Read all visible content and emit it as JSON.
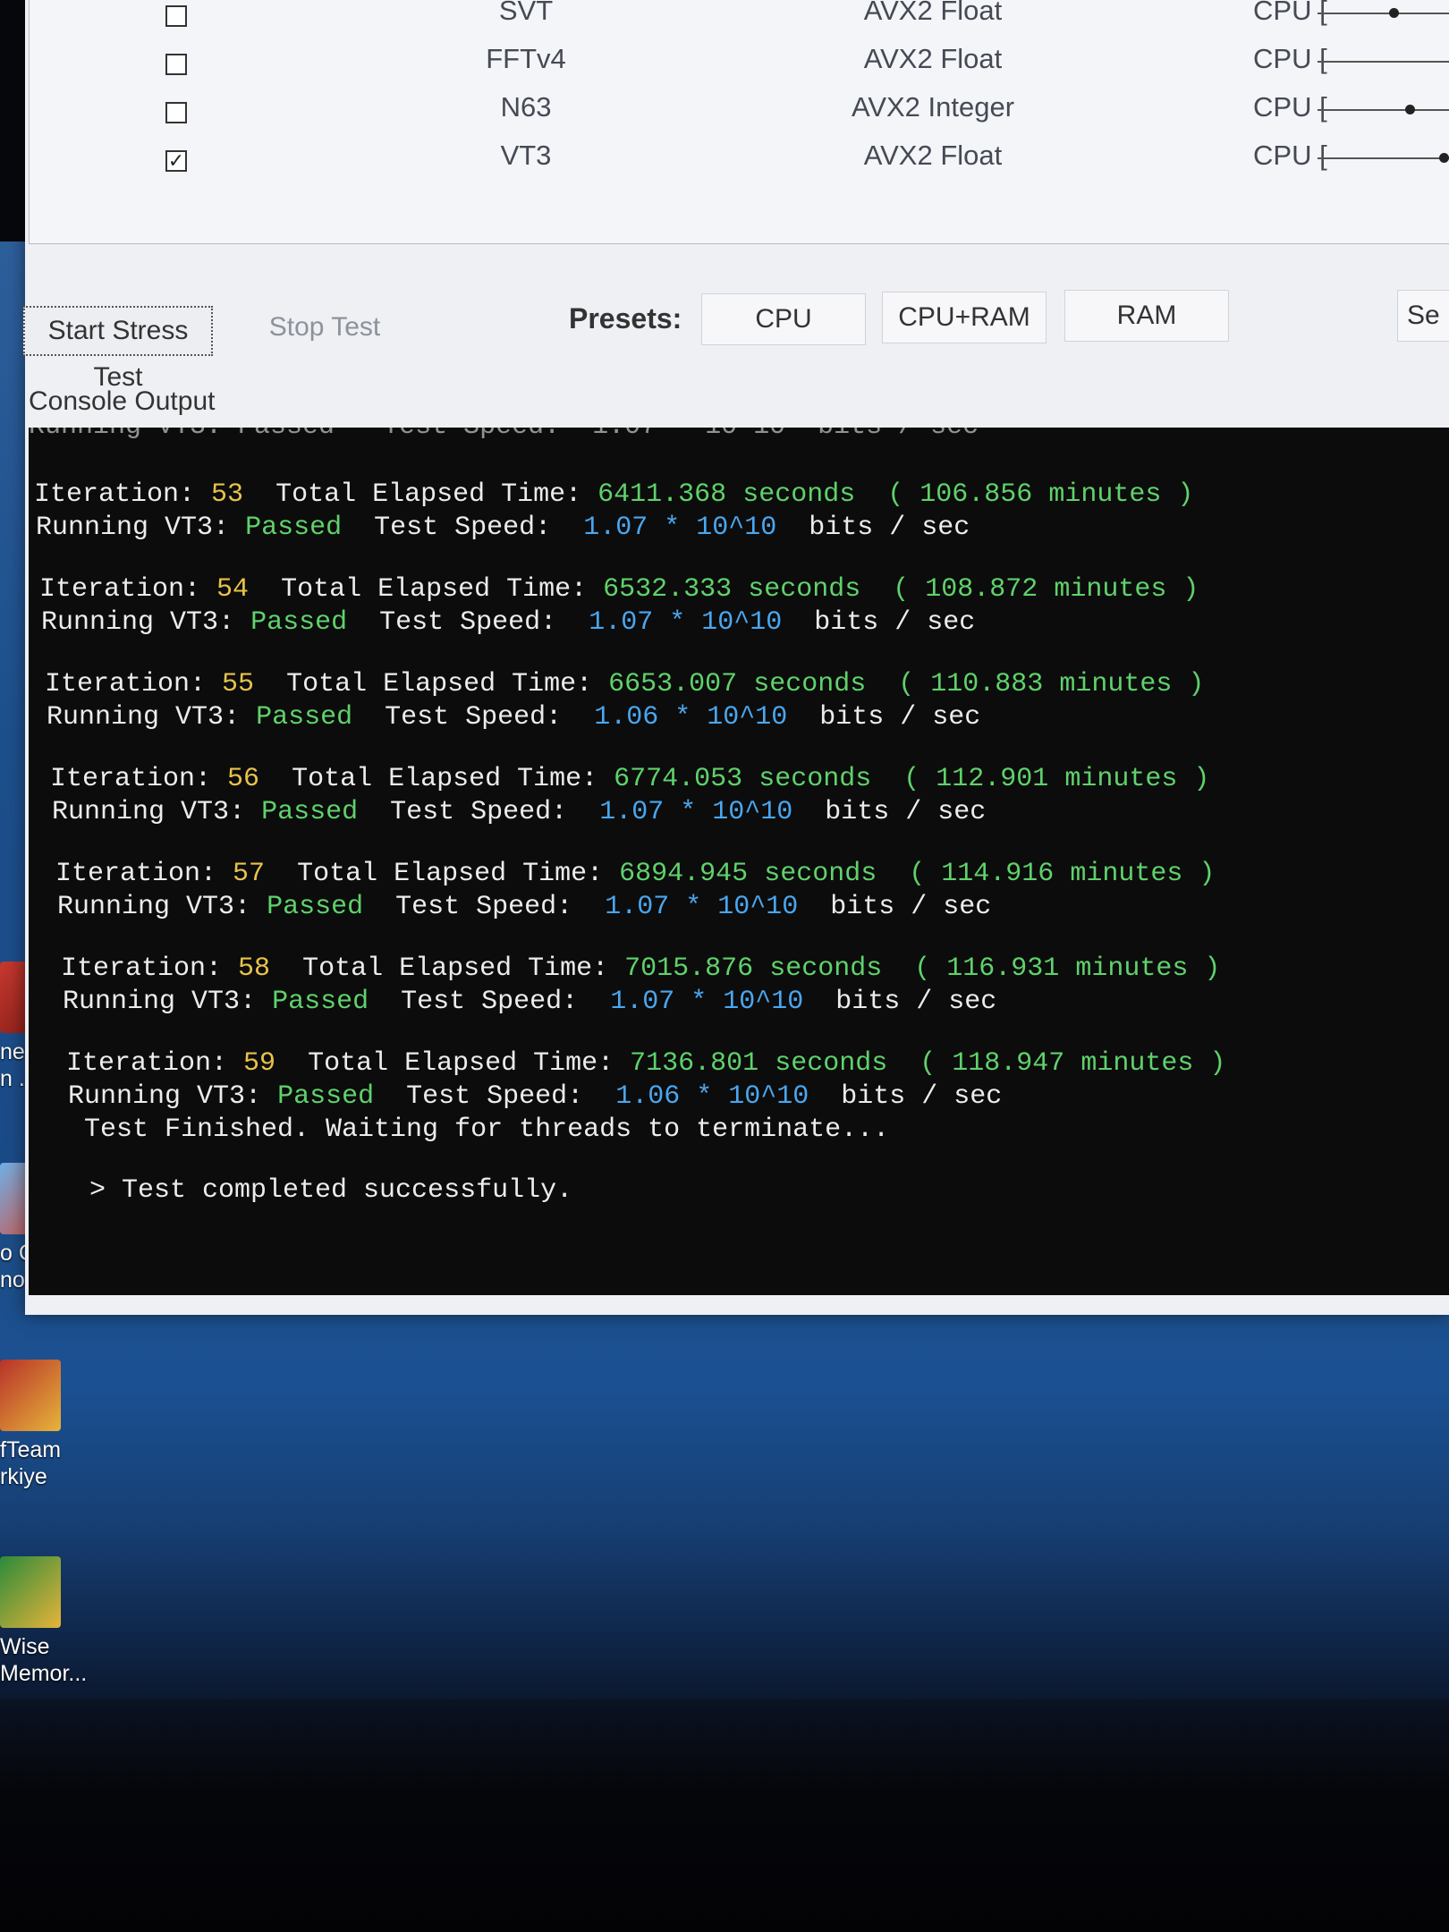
{
  "tests": [
    {
      "name": "SVT",
      "isa": "AVX2 Float",
      "cpu": "CPU [",
      "checked": false
    },
    {
      "name": "FFTv4",
      "isa": "AVX2 Float",
      "cpu": "CPU [",
      "checked": false
    },
    {
      "name": "N63",
      "isa": "AVX2 Integer",
      "cpu": "CPU [",
      "checked": false
    },
    {
      "name": "VT3",
      "isa": "AVX2 Float",
      "cpu": "CPU [",
      "checked": true
    }
  ],
  "toolbar": {
    "start_label": "Start Stress Test",
    "stop_label": "Stop Test",
    "presets_label": "Presets:",
    "preset_cpu": "CPU",
    "preset_cpu_ram": "CPU+RAM",
    "preset_ram": "RAM",
    "preset_more": "Se"
  },
  "console": {
    "label": "Console Output",
    "iterations": [
      {
        "n": "53",
        "seconds": "6411.368",
        "minutes": "106.856",
        "test": "VT3",
        "status": "Passed",
        "speed": "1.07",
        "exp": "10^10"
      },
      {
        "n": "54",
        "seconds": "6532.333",
        "minutes": "108.872",
        "test": "VT3",
        "status": "Passed",
        "speed": "1.07",
        "exp": "10^10"
      },
      {
        "n": "55",
        "seconds": "6653.007",
        "minutes": "110.883",
        "test": "VT3",
        "status": "Passed",
        "speed": "1.06",
        "exp": "10^10"
      },
      {
        "n": "56",
        "seconds": "6774.053",
        "minutes": "112.901",
        "test": "VT3",
        "status": "Passed",
        "speed": "1.07",
        "exp": "10^10"
      },
      {
        "n": "57",
        "seconds": "6894.945",
        "minutes": "114.916",
        "test": "VT3",
        "status": "Passed",
        "speed": "1.07",
        "exp": "10^10"
      },
      {
        "n": "58",
        "seconds": "7015.876",
        "minutes": "116.931",
        "test": "VT3",
        "status": "Passed",
        "speed": "1.07",
        "exp": "10^10"
      },
      {
        "n": "59",
        "seconds": "7136.801",
        "minutes": "118.947",
        "test": "VT3",
        "status": "Passed",
        "speed": "1.06",
        "exp": "10^10"
      }
    ],
    "labels": {
      "iteration": "Iteration:",
      "elapsed": "Total Elapsed Time:",
      "seconds": "seconds",
      "open_paren": "(",
      "minutes": "minutes )",
      "running": "Running",
      "speed": "Test Speed:",
      "times": "*",
      "bits": "bits / sec"
    },
    "finished": "Test Finished. Waiting for threads to terminate...",
    "completed": "> Test completed successfully."
  },
  "desktop_icons": [
    {
      "label": "neft\nn ..."
    },
    {
      "label": "o City\nno"
    },
    {
      "label": "fTeam\nrkiye"
    },
    {
      "label": "Wise\nMemor..."
    }
  ]
}
